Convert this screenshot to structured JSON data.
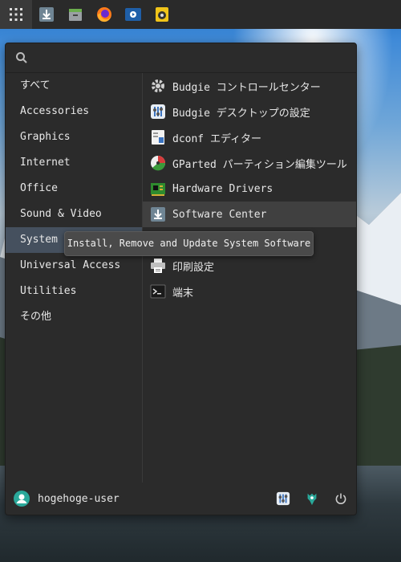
{
  "search": {
    "placeholder": "",
    "value": ""
  },
  "categories": [
    {
      "label": "すべて"
    },
    {
      "label": "Accessories"
    },
    {
      "label": "Graphics"
    },
    {
      "label": "Internet"
    },
    {
      "label": "Office"
    },
    {
      "label": "Sound & Video"
    },
    {
      "label": "System Tools"
    },
    {
      "label": "Universal Access"
    },
    {
      "label": "Utilities"
    },
    {
      "label": "その他"
    }
  ],
  "apps": [
    {
      "label": "Budgie コントロールセンター",
      "icon": "gear-icon"
    },
    {
      "label": "Budgie デスクトップの設定",
      "icon": "budgie-settings-icon"
    },
    {
      "label": "dconf エディター",
      "icon": "dconf-icon"
    },
    {
      "label": "GParted パーティション編集ツール",
      "icon": "gparted-icon"
    },
    {
      "label": "Hardware Drivers",
      "icon": "hardware-icon"
    },
    {
      "label": "Software Center",
      "icon": "download-icon"
    },
    {
      "label": "",
      "icon": "hidden-item"
    },
    {
      "label": "印刷設定",
      "icon": "printer-icon"
    },
    {
      "label": "端末",
      "icon": "terminal-icon"
    }
  ],
  "tooltip": {
    "text": "Install, Remove and Update System Software"
  },
  "user": {
    "name": "hogehoge-user"
  },
  "colors": {
    "panel": "#2a2a2a",
    "menu_bg": "#2b2b2b",
    "active_category": "#45505e",
    "active_app": "#404040"
  }
}
